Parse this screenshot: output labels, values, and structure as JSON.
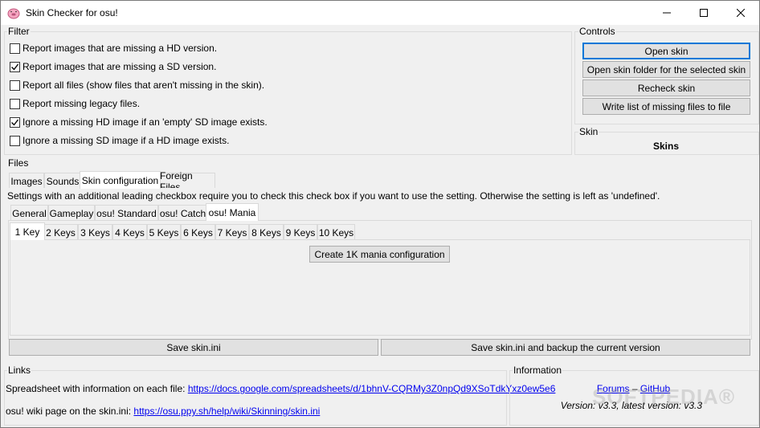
{
  "window": {
    "title": "Skin Checker for osu!"
  },
  "filter": {
    "label": "Filter",
    "options": [
      {
        "label": "Report images that are missing a HD version.",
        "checked": false
      },
      {
        "label": "Report images that are missing a SD version.",
        "checked": true
      },
      {
        "label": "Report all files (show files that aren't missing in the skin).",
        "checked": false
      },
      {
        "label": "Report missing legacy files.",
        "checked": false
      },
      {
        "label": "Ignore a missing HD image if an 'empty' SD image exists.",
        "checked": true
      },
      {
        "label": "Ignore a missing SD image if a HD image exists.",
        "checked": false
      }
    ]
  },
  "controls": {
    "label": "Controls",
    "open_skin": "Open skin",
    "open_folder": "Open skin folder for the selected skin",
    "recheck": "Recheck skin",
    "write_list": "Write list of missing files to file"
  },
  "skin": {
    "label": "Skin",
    "name": "Skins"
  },
  "files": {
    "label": "Files",
    "tabs": [
      "Images",
      "Sounds",
      "Skin configuration",
      "Foreign Files"
    ],
    "active_tab": "Skin configuration",
    "settings_note": "Settings with an additional leading checkbox require you to check this check box if you want to use the setting. Otherwise the setting is left as 'undefined'.",
    "config_tabs": [
      "General",
      "Gameplay",
      "osu! Standard",
      "osu! Catch",
      "osu! Mania"
    ],
    "active_config_tab": "osu! Mania",
    "key_tabs": [
      "1 Key",
      "2 Keys",
      "3 Keys",
      "4 Keys",
      "5 Keys",
      "6 Keys",
      "7 Keys",
      "8 Keys",
      "9 Keys",
      "10 Keys"
    ],
    "active_key_tab": "1 Key",
    "create_config": "Create 1K mania configuration",
    "save": "Save skin.ini",
    "save_backup": "Save skin.ini and backup the current version"
  },
  "links": {
    "label": "Links",
    "spreadsheet_prefix": "Spreadsheet with information on each file: ",
    "spreadsheet_url": "https://docs.google.com/spreadsheets/d/1bhnV-CQRMy3Z0npQd9XSoTdkYxz0ew5e6",
    "wiki_prefix": "osu! wiki page on the skin.ini: ",
    "wiki_url": "https://osu.ppy.sh/help/wiki/Skinning/skin.ini"
  },
  "information": {
    "label": "Information",
    "forums": "Forums",
    "separator": " – ",
    "github": "GitHub",
    "version": "Version: v3.3, latest version: v3.3"
  },
  "watermark": "SOFTPEDIA®"
}
